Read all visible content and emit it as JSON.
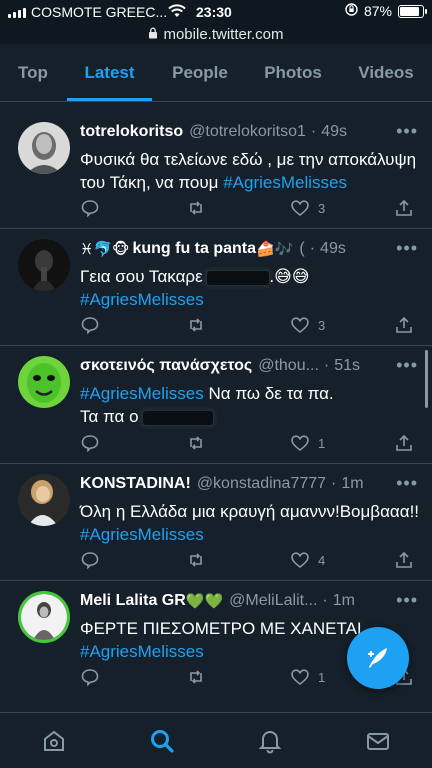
{
  "status": {
    "carrier": "COSMOTE GREEC...",
    "time": "23:30",
    "battery": "87%",
    "battery_level": 0.87
  },
  "url": "mobile.twitter.com",
  "tabs": [
    {
      "label": "Top"
    },
    {
      "label": "Latest",
      "active": true
    },
    {
      "label": "People"
    },
    {
      "label": "Photos"
    },
    {
      "label": "Videos"
    }
  ],
  "tweets": [
    {
      "name": "totrelokoritso",
      "handle": "@totrelokoritso1",
      "time": "49s",
      "text_before": "Φυσικά θα τελείωνε εδώ , με την αποκάλυψη του Τάκη, να πουμ ",
      "hashtag": "#AgriesMelisses",
      "likes": "3"
    },
    {
      "name_emoji": "♓🐬🐵",
      "name": "kung fu ta panta",
      "name_emoji_after": "🍰🎶",
      "handle": "(",
      "time": "49s",
      "text_before": "Γεια σου Τακαρε ",
      "text_after": ".😅😅",
      "hashtag": "#AgriesMelisses",
      "likes": "3"
    },
    {
      "name": "σκοτεινός πανάσχετος",
      "handle": "@thou...",
      "time": "51s",
      "hashtag": "#AgriesMelisses",
      "text_after": " Να πω δε τα πα.",
      "text_line2": "Τα πα ο ",
      "likes": "1"
    },
    {
      "name": "KONSTADINA!",
      "handle": "@konstadina7777",
      "time": "1m",
      "text_before": "Όλη η Ελλάδα μια κραυγή αμαννν!Βομβααα!!",
      "hashtag": "#AgriesMelisses",
      "likes": "4"
    },
    {
      "name": "Meli Lalita GR",
      "name_emoji_after": "💚💚",
      "handle": "@MeliLalit...",
      "time": "1m",
      "text_before": "ΦΕΡΤΕ ΠΙΕΣΟΜΕΤΡΟ ΜΕ ΧΑΝΕΤΑΙ",
      "hashtag": "#AgriesMelisses",
      "likes": "1"
    }
  ],
  "separator": "·",
  "more": "•••",
  "icons": {
    "home": "home-icon",
    "search": "search-icon",
    "notifications": "bell-icon",
    "messages": "mail-icon",
    "compose": "compose-icon"
  },
  "colors": {
    "accent": "#1da1f2",
    "background": "#15202b",
    "muted": "#8899a6"
  }
}
